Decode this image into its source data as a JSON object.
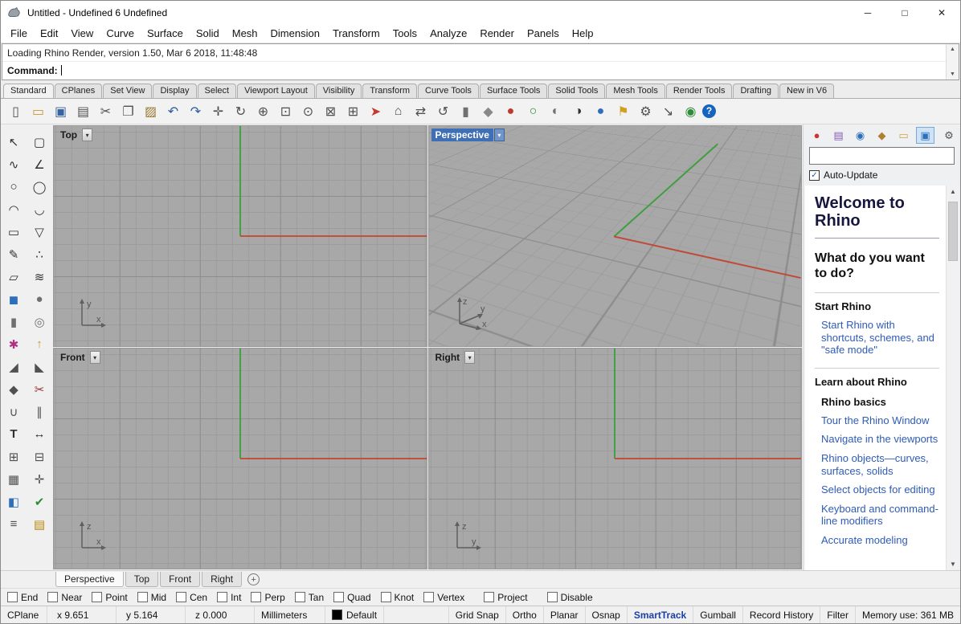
{
  "window": {
    "title": "Untitled - Undefined 6 Undefined"
  },
  "icons": {
    "minimize": "─",
    "maximize": "□",
    "close": "✕",
    "dropdown": "▾",
    "scroll_up": "▲",
    "scroll_down": "▼",
    "plus": "+",
    "check": "✓",
    "gear": "⚙"
  },
  "menu": {
    "items": [
      {
        "label": "File",
        "name": "menu-file"
      },
      {
        "label": "Edit",
        "name": "menu-edit"
      },
      {
        "label": "View",
        "name": "menu-view"
      },
      {
        "label": "Curve",
        "name": "menu-curve"
      },
      {
        "label": "Surface",
        "name": "menu-surface"
      },
      {
        "label": "Solid",
        "name": "menu-solid"
      },
      {
        "label": "Mesh",
        "name": "menu-mesh"
      },
      {
        "label": "Dimension",
        "name": "menu-dimension"
      },
      {
        "label": "Transform",
        "name": "menu-transform"
      },
      {
        "label": "Tools",
        "name": "menu-tools"
      },
      {
        "label": "Analyze",
        "name": "menu-analyze"
      },
      {
        "label": "Render",
        "name": "menu-render"
      },
      {
        "label": "Panels",
        "name": "menu-panels"
      },
      {
        "label": "Help",
        "name": "menu-help"
      }
    ]
  },
  "command": {
    "history": "Loading Rhino Render, version 1.50, Mar  6 2018, 11:48:48",
    "prompt": "Command:"
  },
  "toolbar_tabs": {
    "items": [
      {
        "label": "Standard",
        "name": "tab-standard",
        "active": true
      },
      {
        "label": "CPlanes",
        "name": "tab-cplanes"
      },
      {
        "label": "Set View",
        "name": "tab-set-view"
      },
      {
        "label": "Display",
        "name": "tab-display"
      },
      {
        "label": "Select",
        "name": "tab-select"
      },
      {
        "label": "Viewport Layout",
        "name": "tab-viewport-layout"
      },
      {
        "label": "Visibility",
        "name": "tab-visibility"
      },
      {
        "label": "Transform",
        "name": "tab-transform"
      },
      {
        "label": "Curve Tools",
        "name": "tab-curve-tools"
      },
      {
        "label": "Surface Tools",
        "name": "tab-surface-tools"
      },
      {
        "label": "Solid Tools",
        "name": "tab-solid-tools"
      },
      {
        "label": "Mesh Tools",
        "name": "tab-mesh-tools"
      },
      {
        "label": "Render Tools",
        "name": "tab-render-tools"
      },
      {
        "label": "Drafting",
        "name": "tab-drafting"
      },
      {
        "label": "New in V6",
        "name": "tab-new-in-v6"
      }
    ]
  },
  "toolbar": {
    "icons": [
      {
        "name": "new-file-icon",
        "glyph": "▯",
        "style": "color:#505050"
      },
      {
        "name": "open-file-icon",
        "glyph": "▭",
        "style": "color:#c9972c"
      },
      {
        "name": "save-icon",
        "glyph": "▣",
        "style": "color:#39629e"
      },
      {
        "name": "print-icon",
        "glyph": "▤",
        "style": "color:#505050"
      },
      {
        "name": "cut-icon",
        "glyph": "✂",
        "style": "color:#505050"
      },
      {
        "name": "copy-icon",
        "glyph": "❐",
        "style": "color:#505050"
      },
      {
        "name": "paste-icon",
        "glyph": "▨",
        "style": "color:#96762f"
      },
      {
        "name": "undo-icon",
        "glyph": "↶",
        "style": "color:#2f5e9e"
      },
      {
        "name": "redo-icon",
        "glyph": "↷",
        "style": "color:#2f5e9e"
      },
      {
        "name": "pan-hand-icon",
        "glyph": "✛",
        "style": "color:#505050"
      },
      {
        "name": "rotate-view-icon",
        "glyph": "↻",
        "style": "color:#505050"
      },
      {
        "name": "zoom-dynamic-icon",
        "glyph": "⊕",
        "style": "color:#505050"
      },
      {
        "name": "zoom-window-icon",
        "glyph": "⊡",
        "style": "color:#505050"
      },
      {
        "name": "zoom-selected-icon",
        "glyph": "⊙",
        "style": "color:#505050"
      },
      {
        "name": "zoom-extents-icon",
        "glyph": "⊠",
        "style": "color:#505050"
      },
      {
        "name": "four-viewports-icon",
        "glyph": "⊞",
        "style": "color:#505050"
      },
      {
        "name": "car-icon",
        "glyph": "➤",
        "style": "color:#c23b2e"
      },
      {
        "name": "home-view-icon",
        "glyph": "⌂",
        "style": "color:#505050"
      },
      {
        "name": "pan-view-icon",
        "glyph": "⇄",
        "style": "color:#505050"
      },
      {
        "name": "rotate-camera-icon",
        "glyph": "↺",
        "style": "color:#505050"
      },
      {
        "name": "cylinder-icon",
        "glyph": "▮",
        "style": "color:#707070"
      },
      {
        "name": "gumball-icon",
        "glyph": "◆",
        "style": "color:#888888"
      },
      {
        "name": "render-icon",
        "glyph": "●",
        "style": "color:#c0392b"
      },
      {
        "name": "wireframe-icon",
        "glyph": "○",
        "style": "color:#2e8b3a"
      },
      {
        "name": "shaded-icon",
        "glyph": "◐",
        "style": "color:#707070"
      },
      {
        "name": "rendered-icon",
        "glyph": "◑",
        "style": "color:#30303a"
      },
      {
        "name": "raytraced-icon",
        "glyph": "●",
        "style": "color:#2e6fbd"
      },
      {
        "name": "flag-icon",
        "glyph": "⚑",
        "style": "color:#d0a020"
      },
      {
        "name": "options-gear-icon",
        "glyph": "⚙",
        "style": "color:#505050"
      },
      {
        "name": "scale-icon",
        "glyph": "↘",
        "style": "color:#505050"
      },
      {
        "name": "earth-icon",
        "glyph": "◉",
        "style": "color:#2e8b3a"
      },
      {
        "name": "help-icon",
        "glyph": "?",
        "style": "background:#1565c0;color:#ffffff;border-radius:50%;width:17px;height:17px;line-height:17px;font-size:12px;font-weight:bold;display:inline-block;text-align:center"
      }
    ]
  },
  "sidebar": {
    "icons": [
      {
        "name": "select-icon",
        "glyph": "↖",
        "style": "color:#303030"
      },
      {
        "name": "lasso-select-icon",
        "glyph": "▢",
        "style": "color:#303030"
      },
      {
        "name": "control-point-curve-icon",
        "glyph": "∿",
        "style": "color:#303030"
      },
      {
        "name": "polyline-icon",
        "glyph": "∠",
        "style": "color:#303030"
      },
      {
        "name": "circle-icon",
        "glyph": "○",
        "style": "color:#303030"
      },
      {
        "name": "ellipse-icon",
        "glyph": "◯",
        "style": "color:#303030"
      },
      {
        "name": "arc-icon",
        "glyph": "◠",
        "style": "color:#303030"
      },
      {
        "name": "freeform-curve-icon",
        "glyph": "◡",
        "style": "color:#303030"
      },
      {
        "name": "rectangle-icon",
        "glyph": "▭",
        "style": "color:#303030"
      },
      {
        "name": "polygon-icon",
        "glyph": "▽",
        "style": "color:#303030"
      },
      {
        "name": "curve-tools-icon",
        "glyph": "✎",
        "style": "color:#303030"
      },
      {
        "name": "point-icon",
        "glyph": "∴",
        "style": "color:#303030"
      },
      {
        "name": "surface-icon",
        "glyph": "▱",
        "style": "color:#303030"
      },
      {
        "name": "loft-icon",
        "glyph": "≋",
        "style": "color:#303030"
      },
      {
        "name": "box-icon",
        "glyph": "◼",
        "style": "color:#2e6fbd"
      },
      {
        "name": "sphere-icon",
        "glyph": "●",
        "style": "color:#707070"
      },
      {
        "name": "cylinder-solid-icon",
        "glyph": "▮",
        "style": "color:#707070"
      },
      {
        "name": "tube-icon",
        "glyph": "◎",
        "style": "color:#707070"
      },
      {
        "name": "surface-tools-icon",
        "glyph": "✱",
        "style": "color:#b03080"
      },
      {
        "name": "extrude-icon",
        "glyph": "↑",
        "style": "color:#c99a2c"
      },
      {
        "name": "fillet-icon",
        "glyph": "◢",
        "style": "color:#505050"
      },
      {
        "name": "chamfer-icon",
        "glyph": "◣",
        "style": "color:#505050"
      },
      {
        "name": "boolean-icon",
        "glyph": "◆",
        "style": "color:#505050"
      },
      {
        "name": "trim-icon",
        "glyph": "✂",
        "style": "color:#a03030"
      },
      {
        "name": "join-icon",
        "glyph": "∪",
        "style": "color:#505050"
      },
      {
        "name": "split-icon",
        "glyph": "∥",
        "style": "color:#505050"
      },
      {
        "name": "text-icon",
        "glyph": "T",
        "style": "color:#303030;font-weight:bold"
      },
      {
        "name": "dimension-icon",
        "glyph": "↔",
        "style": "color:#303030"
      },
      {
        "name": "block-icon",
        "glyph": "⊞",
        "style": "color:#505050"
      },
      {
        "name": "array-icon",
        "glyph": "⊟",
        "style": "color:#505050"
      },
      {
        "name": "grid-icon",
        "glyph": "▦",
        "style": "color:#505050"
      },
      {
        "name": "snap-icon",
        "glyph": "✛",
        "style": "color:#505050"
      },
      {
        "name": "paint-icon",
        "glyph": "◧",
        "style": "color:#2e6fbd"
      },
      {
        "name": "check-icon",
        "glyph": "✔",
        "style": "color:#2e8b3a"
      },
      {
        "name": "layers-icon",
        "glyph": "≡",
        "style": "color:#505050"
      },
      {
        "name": "notes-icon",
        "glyph": "▤",
        "style": "color:#b8860b"
      }
    ]
  },
  "viewports": {
    "top": {
      "label": "Top",
      "vaxis": "y",
      "haxis": "x"
    },
    "perspective": {
      "label": "Perspective",
      "a_up": "z",
      "a_mid": "y",
      "a_low": "x"
    },
    "front": {
      "label": "Front",
      "vaxis": "z",
      "haxis": "x"
    },
    "right": {
      "label": "Right",
      "vaxis": "z",
      "haxis": "y"
    }
  },
  "viewport_tabs": {
    "items": [
      {
        "label": "Perspective",
        "name": "vptab-perspective",
        "active": true
      },
      {
        "label": "Top",
        "name": "vptab-top"
      },
      {
        "label": "Front",
        "name": "vptab-front"
      },
      {
        "label": "Right",
        "name": "vptab-right"
      }
    ]
  },
  "osnap": {
    "items": [
      {
        "label": "End",
        "name": "osnap-end"
      },
      {
        "label": "Near",
        "name": "osnap-near"
      },
      {
        "label": "Point",
        "name": "osnap-point"
      },
      {
        "label": "Mid",
        "name": "osnap-mid"
      },
      {
        "label": "Cen",
        "name": "osnap-cen"
      },
      {
        "label": "Int",
        "name": "osnap-int"
      },
      {
        "label": "Perp",
        "name": "osnap-perp"
      },
      {
        "label": "Tan",
        "name": "osnap-tan"
      },
      {
        "label": "Quad",
        "name": "osnap-quad"
      },
      {
        "label": "Knot",
        "name": "osnap-knot"
      },
      {
        "label": "Vertex",
        "name": "osnap-vertex"
      },
      {
        "label": "Project",
        "name": "osnap-project",
        "gap": true
      },
      {
        "label": "Disable",
        "name": "osnap-disable",
        "gap": true
      }
    ]
  },
  "statusbar": {
    "cplane": "CPlane",
    "x": "x 9.651",
    "y": "y 5.164",
    "z": "z 0.000",
    "units": "Millimeters",
    "layer": "Default",
    "layer_swatch": "background:#000000",
    "toggles": [
      {
        "label": "Grid Snap",
        "name": "grid-snap-toggle"
      },
      {
        "label": "Ortho",
        "name": "ortho-toggle"
      },
      {
        "label": "Planar",
        "name": "planar-toggle"
      },
      {
        "label": "Osnap",
        "name": "osnap-toggle"
      },
      {
        "label": "SmartTrack",
        "name": "smarttrack-toggle",
        "accent": true
      },
      {
        "label": "Gumball",
        "name": "gumball-toggle"
      },
      {
        "label": "Record History",
        "name": "record-history-toggle"
      },
      {
        "label": "Filter",
        "name": "filter-toggle"
      }
    ],
    "memory": "Memory use: 361 MB"
  },
  "panel": {
    "tabs": [
      {
        "name": "properties-panel-tab",
        "glyph": "●",
        "style": "color:#cc3333"
      },
      {
        "name": "layers-panel-tab",
        "glyph": "▤",
        "style": "color:#8a5bb8"
      },
      {
        "name": "display-panel-tab",
        "glyph": "◉",
        "style": "color:#2e6fbd"
      },
      {
        "name": "materials-panel-tab",
        "glyph": "◆",
        "style": "color:#b08030"
      },
      {
        "name": "libraries-panel-tab",
        "glyph": "▭",
        "style": "color:#d1a33c"
      },
      {
        "name": "help-panel-tab",
        "glyph": "▣",
        "style": "color:#2e6fbd",
        "active": true
      }
    ],
    "search": {
      "value": ""
    },
    "auto_update": {
      "label": "Auto-Update",
      "checked": true
    },
    "help": {
      "title": "Welcome to Rhino",
      "subtitle": "What do you want to do?",
      "rows": [
        {
          "type": "h3",
          "text": "Start Rhino",
          "interactable": "false"
        },
        {
          "type": "link",
          "text": "Start Rhino with shortcuts, schemes, and \"safe mode\"",
          "interactable": "true"
        },
        {
          "type": "h3",
          "text": "Learn about Rhino",
          "interactable": "false"
        },
        {
          "type": "h4",
          "text": "Rhino basics",
          "interactable": "false"
        },
        {
          "type": "link",
          "text": "Tour the Rhino Window",
          "interactable": "true"
        },
        {
          "type": "link",
          "text": "Navigate in the viewports",
          "interactable": "true"
        },
        {
          "type": "link",
          "text": "Rhino objects—curves, surfaces, solids",
          "interactable": "true"
        },
        {
          "type": "link",
          "text": "Select objects for editing",
          "interactable": "true"
        },
        {
          "type": "link",
          "text": "Keyboard and command-line modifiers",
          "interactable": "true"
        },
        {
          "type": "link",
          "text": "Accurate modeling",
          "interactable": "true"
        }
      ]
    }
  }
}
